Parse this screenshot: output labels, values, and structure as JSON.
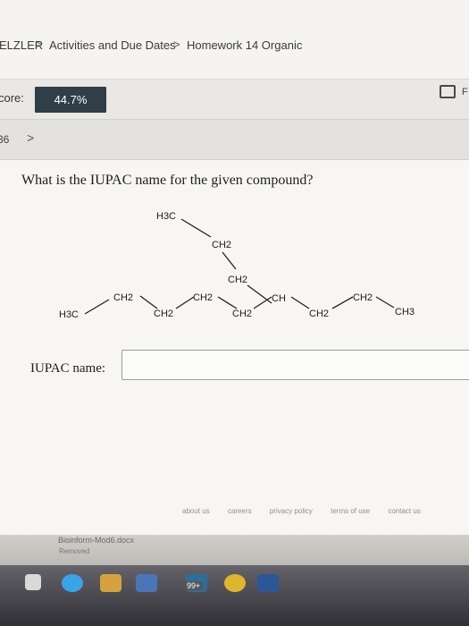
{
  "breadcrumb": {
    "items": [
      "ELZLER",
      "Activities and Due Dates",
      "Homework 14 Organic"
    ],
    "separator": ">"
  },
  "score": {
    "label": "core:",
    "value": "44.7%"
  },
  "print_letter": "F",
  "question_nav": {
    "number": "36",
    "next_arrow": ">"
  },
  "question": {
    "prompt": "What is the IUPAC name for the given compound?",
    "structure_groups": [
      "H3C",
      "CH2",
      "CH2",
      "CH",
      "CH2",
      "CH3",
      "H3C",
      "CH2",
      "CH2",
      "CH2",
      "CH2",
      "CH2"
    ]
  },
  "answer": {
    "label": "IUPAC name:",
    "value": ""
  },
  "footer": {
    "links": [
      "about us",
      "careers",
      "privacy policy",
      "terms of use",
      "contact us"
    ]
  },
  "download": {
    "file": "Bioinform-Mod6.docx",
    "status": "Removed"
  },
  "taskbar": {
    "badge": "99+"
  },
  "colors": {
    "score_bg": "#2f3e48",
    "page_bg": "#f7f6f3",
    "taskbar": "#3e3d44"
  },
  "icons": [
    "print-icon",
    "chevron-right-icon",
    "windows-icon",
    "edge-icon",
    "file-explorer-icon",
    "store-icon",
    "chrome-icon",
    "word-icon"
  ]
}
